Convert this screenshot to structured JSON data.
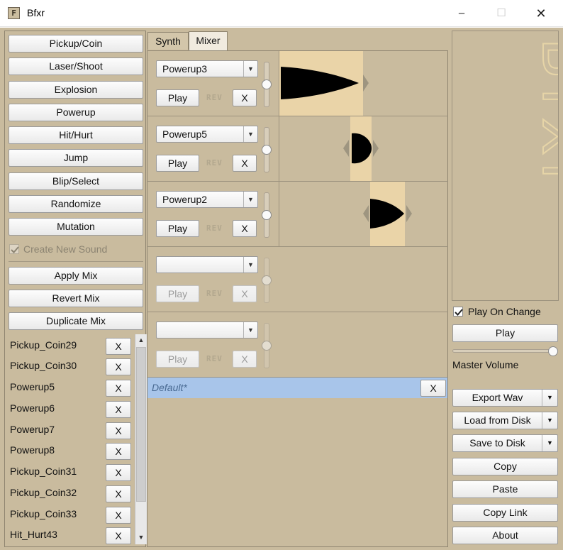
{
  "window": {
    "title": "Bfxr",
    "icon_glyph": "F",
    "controls": {
      "minimize": "–",
      "maximize": "☐",
      "close": "✕"
    }
  },
  "generators": [
    {
      "label": "Pickup/Coin"
    },
    {
      "label": "Laser/Shoot"
    },
    {
      "label": "Explosion"
    },
    {
      "label": "Powerup"
    },
    {
      "label": "Hit/Hurt"
    },
    {
      "label": "Jump"
    },
    {
      "label": "Blip/Select"
    },
    {
      "label": "Randomize"
    },
    {
      "label": "Mutation"
    }
  ],
  "create_new_sound": {
    "label": "Create New Sound",
    "checked": true,
    "enabled": false
  },
  "mix_actions": [
    {
      "label": "Apply Mix"
    },
    {
      "label": "Revert Mix"
    },
    {
      "label": "Duplicate Mix"
    }
  ],
  "sound_list": [
    {
      "name": "Pickup_Coin29",
      "remove": "X"
    },
    {
      "name": "Pickup_Coin30",
      "remove": "X"
    },
    {
      "name": "Powerup5",
      "remove": "X"
    },
    {
      "name": "Powerup6",
      "remove": "X"
    },
    {
      "name": "Powerup7",
      "remove": "X"
    },
    {
      "name": "Powerup8",
      "remove": "X"
    },
    {
      "name": "Pickup_Coin31",
      "remove": "X"
    },
    {
      "name": "Pickup_Coin32",
      "remove": "X"
    },
    {
      "name": "Pickup_Coin33",
      "remove": "X"
    },
    {
      "name": "Hit_Hurt43",
      "remove": "X"
    }
  ],
  "scrollbar": {
    "up": "▲",
    "down": "▼"
  },
  "tabs": {
    "synth": "Synth",
    "mixer": "Mixer",
    "active": "Mixer"
  },
  "tracks": [
    {
      "sound": "Powerup3",
      "play": "Play",
      "rev": "REV",
      "remove": "X",
      "enabled": true
    },
    {
      "sound": "Powerup5",
      "play": "Play",
      "rev": "REV",
      "remove": "X",
      "enabled": true
    },
    {
      "sound": "Powerup2",
      "play": "Play",
      "rev": "REV",
      "remove": "X",
      "enabled": true
    },
    {
      "sound": "",
      "play": "Play",
      "rev": "REV",
      "remove": "X",
      "enabled": false
    },
    {
      "sound": "",
      "play": "Play",
      "rev": "REV",
      "remove": "X",
      "enabled": false
    }
  ],
  "combo_arrow": "▼",
  "mixes": [
    {
      "name": "Default*",
      "remove": "X",
      "selected": true
    }
  ],
  "right_panel": {
    "logo_text": "Bfxr",
    "play_on_change": {
      "label": "Play On Change",
      "checked": true
    },
    "play": "Play",
    "master_volume": {
      "label": "Master Volume",
      "level": 1.0
    },
    "export_wav": "Export Wav",
    "load_from_disk": "Load from Disk",
    "save_to_disk": "Save to Disk",
    "copy": "Copy",
    "paste": "Paste",
    "copy_link": "Copy Link",
    "about": "About"
  },
  "colors": {
    "background": "#c9bb9e",
    "waveform_highlight": "#ead4a8",
    "selection": "#a8c5ea",
    "logo": "#e6d4a7"
  }
}
